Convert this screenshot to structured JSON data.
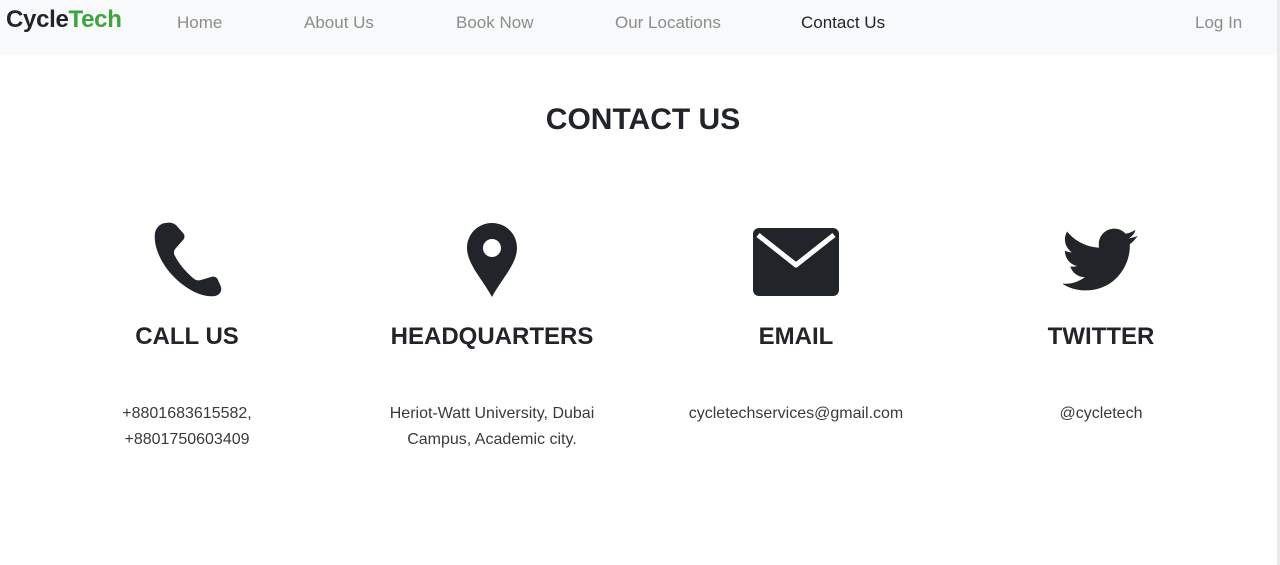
{
  "brand": {
    "part1": "Cycle",
    "part2": "Tech"
  },
  "nav": {
    "items": [
      "Home",
      "About Us",
      "Book Now",
      "Our Locations",
      "Contact Us"
    ],
    "login": "Log In"
  },
  "page": {
    "title": "CONTACT US"
  },
  "cards": [
    {
      "icon": "phone-icon",
      "heading": "CALL US",
      "lines": [
        "+8801683615582,",
        "+8801750603409"
      ]
    },
    {
      "icon": "location-pin-icon",
      "heading": "HEADQUARTERS",
      "lines": [
        "Heriot-Watt University, Dubai",
        "Campus, Academic city."
      ]
    },
    {
      "icon": "envelope-icon",
      "heading": "EMAIL",
      "lines": [
        "cycletechservices@gmail.com"
      ]
    },
    {
      "icon": "twitter-bird-icon",
      "heading": "TWITTER",
      "lines": [
        "@cycletech"
      ]
    }
  ],
  "colors": {
    "brand_accent": "#3aa63a",
    "text": "#212529",
    "nav_bg": "#f8f9fa",
    "nav_muted": "#8c8c8c"
  }
}
